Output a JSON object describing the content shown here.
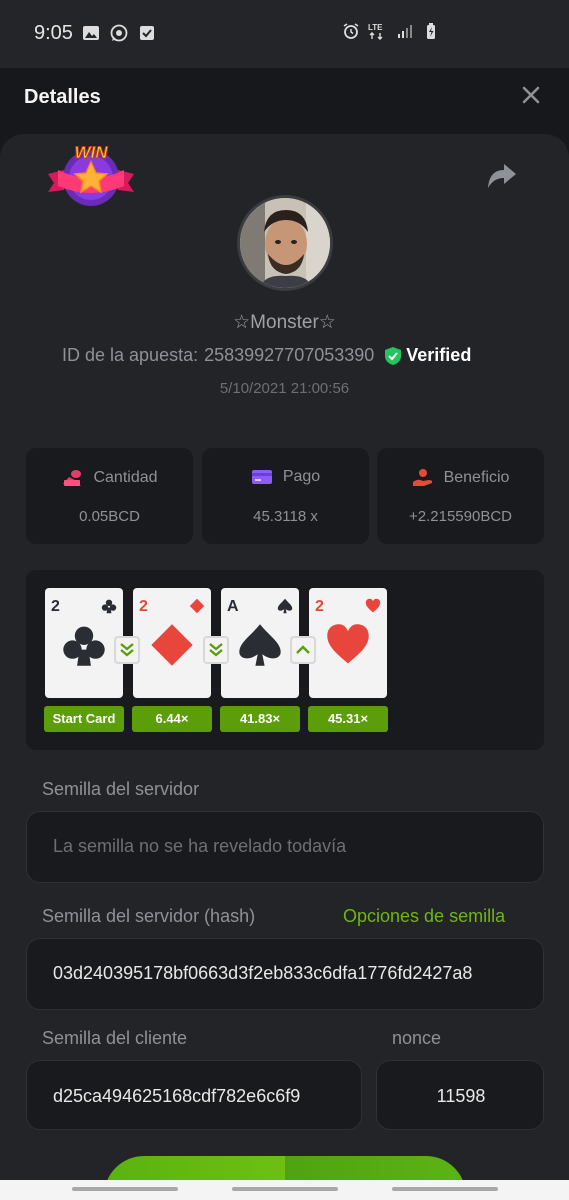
{
  "status_bar": {
    "time": "9:05"
  },
  "header": {
    "title": "Detalles"
  },
  "player": {
    "name": "☆Monster☆"
  },
  "bet": {
    "id_label": "ID de la apuesta:",
    "id_value": "25839927707053390",
    "verified_label": "Verified",
    "date": "5/10/2021 21:00:56"
  },
  "stats": [
    {
      "label": "Cantidad",
      "value": "0.05BCD",
      "icon": "coins-icon"
    },
    {
      "label": "Pago",
      "value": "45.3118 x",
      "icon": "card-icon"
    },
    {
      "label": "Beneficio",
      "value": "+2.215590BCD",
      "icon": "hand-coin-icon"
    }
  ],
  "hand": {
    "cards": [
      {
        "rank": "2",
        "suit": "clubs"
      },
      {
        "rank": "2",
        "suit": "diamonds"
      },
      {
        "rank": "A",
        "suit": "spades"
      },
      {
        "rank": "2",
        "suit": "hearts"
      }
    ],
    "guesses": [
      "lower",
      "lower",
      "higher"
    ],
    "multipliers": [
      "Start Card",
      "6.44×",
      "41.83×",
      "45.31×"
    ]
  },
  "seeds": {
    "server_seed_label": "Semilla del servidor",
    "server_seed_value": "La semilla no se ha revelado todavía",
    "server_hash_label": "Semilla del servidor (hash)",
    "seed_options_link": "Opciones de semilla",
    "server_hash_value": "03d240395178bf0663d3f2eb833c6dfa1776fd2427a8",
    "client_seed_label": "Semilla del cliente",
    "client_seed_value": "d25ca494625168cdf782e6c6f9",
    "nonce_label": "nonce",
    "nonce_value": "11598"
  },
  "colors": {
    "accent_green": "#6fb614",
    "multiplier_green": "#5b9e0a",
    "verified_green": "#22c55e",
    "red_suit": "#e8453c",
    "dark_suit": "#2a2d33"
  }
}
